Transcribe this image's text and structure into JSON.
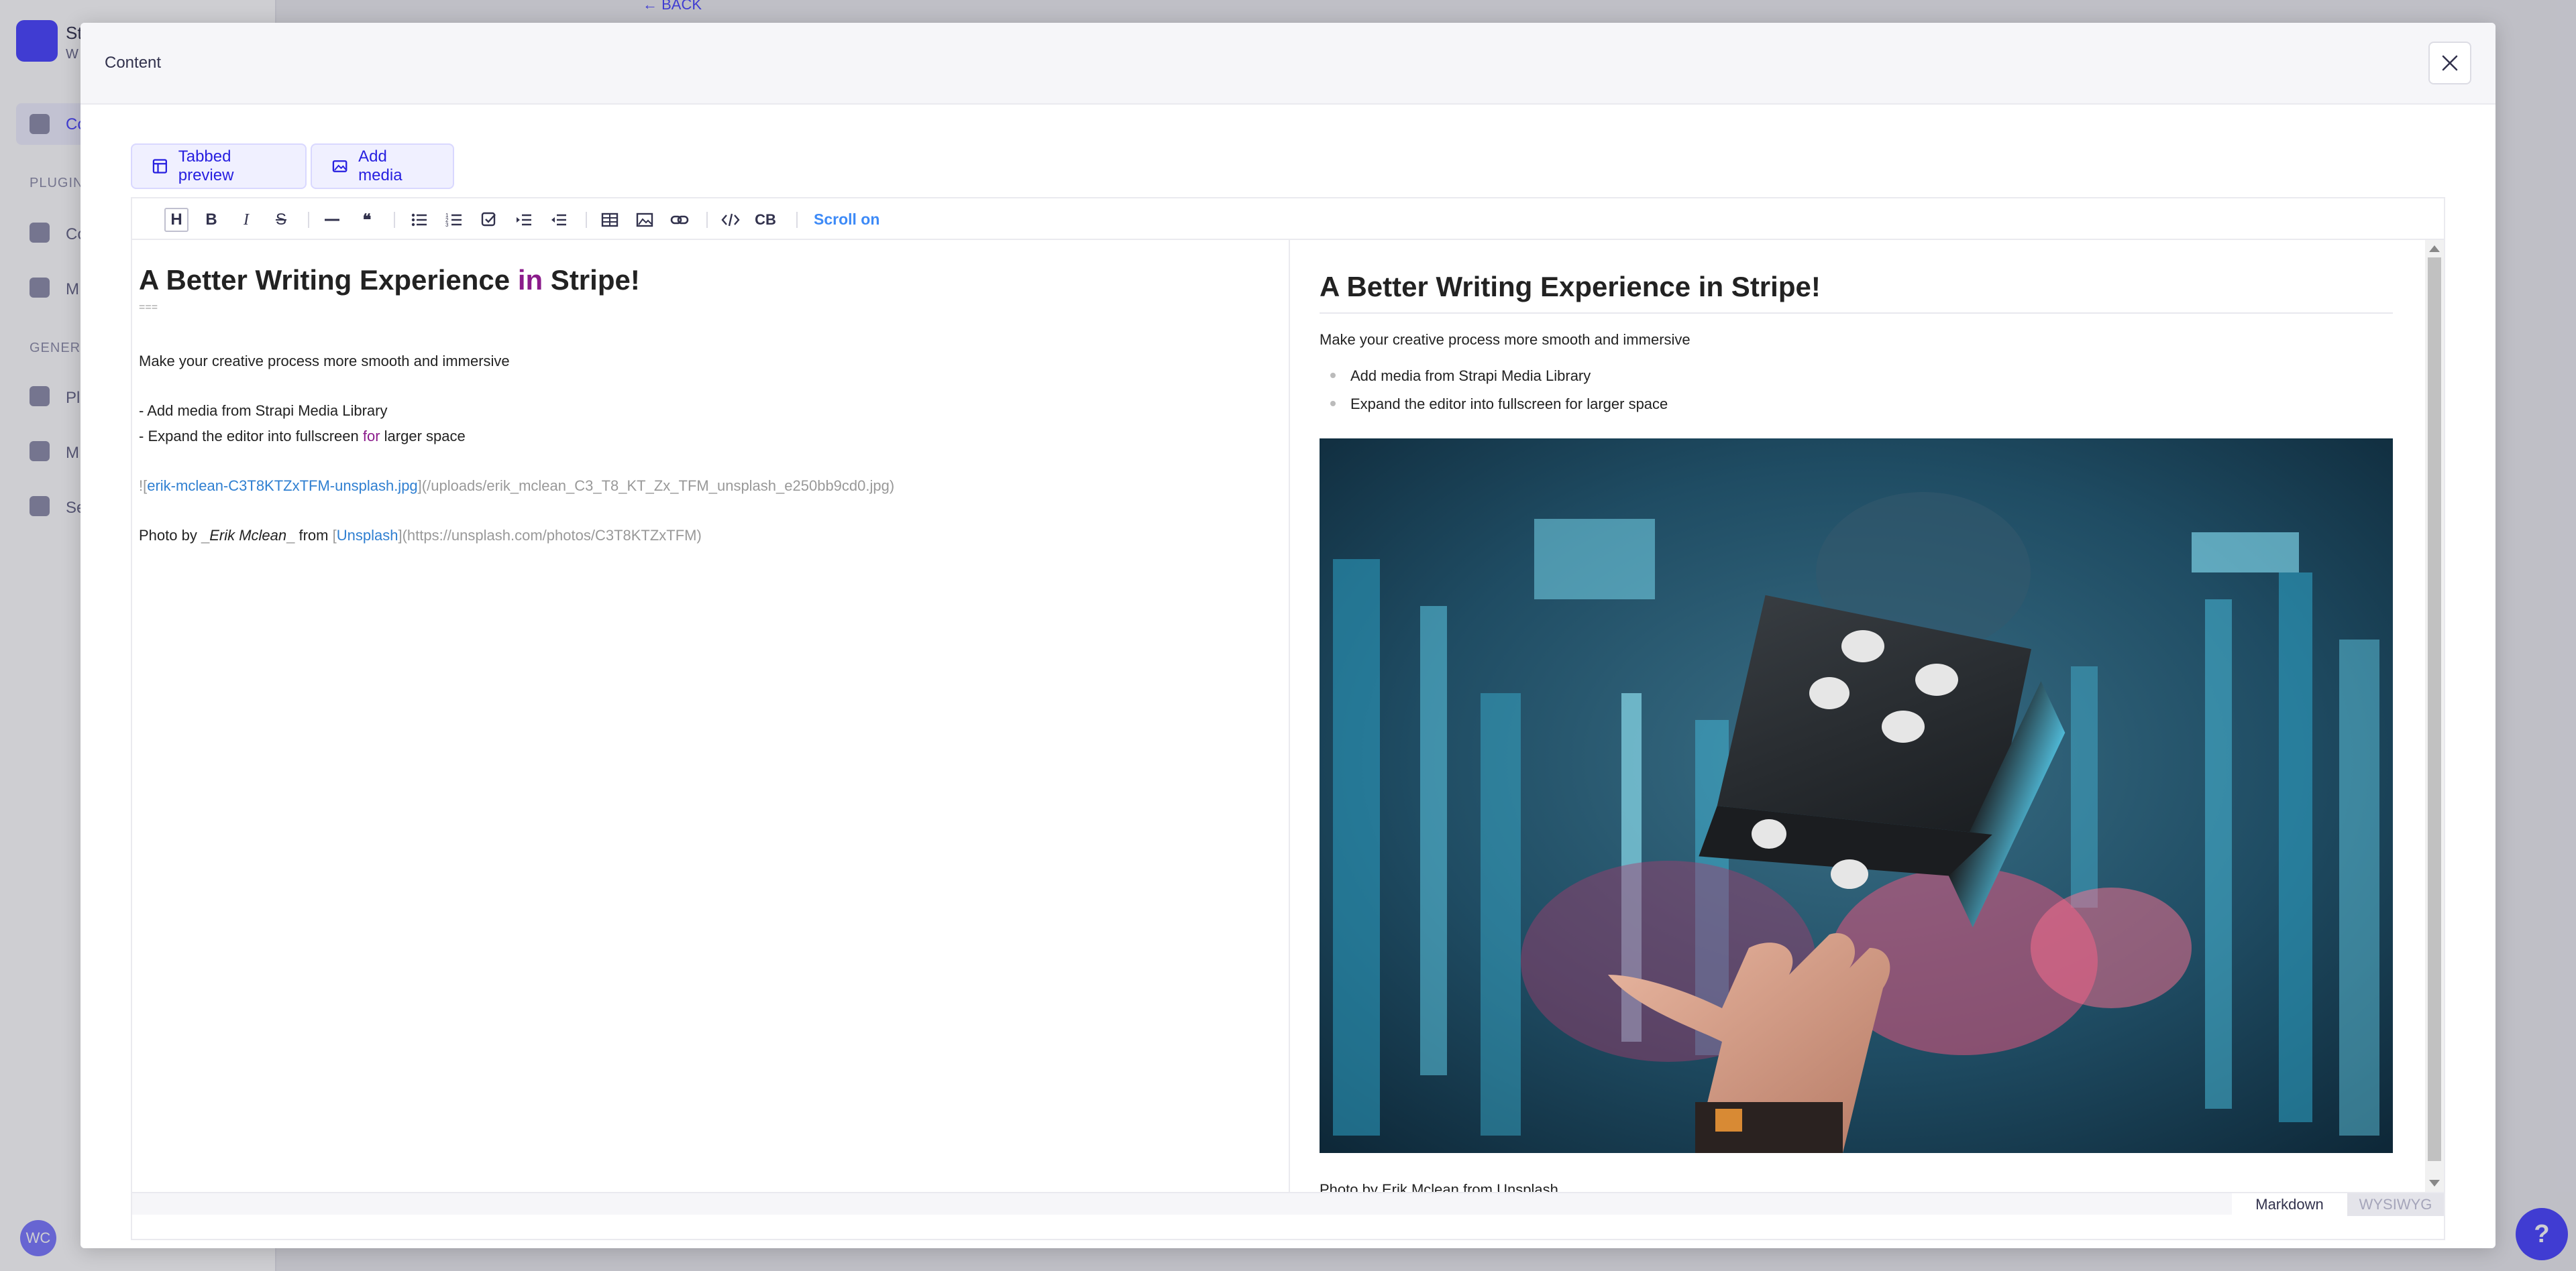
{
  "background": {
    "brand": "St",
    "brand_sub": "W",
    "nav_active": "Co",
    "section_plugins": "PLUGIN",
    "plugin_items": [
      "Co",
      "M"
    ],
    "section_general": "GENERA",
    "general_items": [
      "Pl",
      "M",
      "Se"
    ],
    "back_link": "← BACK",
    "avatar": "WC",
    "help": "?"
  },
  "modal": {
    "title": "Content",
    "close_icon": "close-icon"
  },
  "actions": {
    "tabbed_preview": "Tabbed preview",
    "add_media": "Add media"
  },
  "toolbar": {
    "heading": "H",
    "bold": "B",
    "italic": "I",
    "strike": "S",
    "quote": "❝",
    "code_block": "CB",
    "scroll_on": "Scroll on",
    "icons": [
      "heading-icon",
      "bold-icon",
      "italic-icon",
      "strikethrough-icon",
      "horizontal-rule-icon",
      "quote-icon",
      "bullet-list-icon",
      "ordered-list-icon",
      "task-list-icon",
      "indent-icon",
      "outdent-icon",
      "table-icon",
      "image-icon",
      "link-icon",
      "code-icon",
      "code-block-icon"
    ]
  },
  "markdown": {
    "h1_before": "A Better Writing Experience ",
    "h1_keyword": "in",
    "h1_after": " Stripe!",
    "underline": "===",
    "paragraph": "Make your creative process more smooth and immersive",
    "list_1": "- Add media from Strapi Media Library",
    "list_2_before": "- Expand the editor into fullscreen ",
    "list_2_keyword": "for",
    "list_2_after": " larger space",
    "img_bang": "![",
    "img_alt": "erik-mclean-C3T8KTZxTFM-unsplash.jpg",
    "img_url": "](/uploads/erik_mclean_C3_T8_KT_Zx_TFM_unsplash_e250bb9cd0.jpg)",
    "caption_text": "Photo by ",
    "caption_mark_open": "_",
    "caption_author": "Erik Mclean",
    "caption_mark_close": "_",
    "caption_from": " from ",
    "caption_bracket": "[",
    "caption_site": "Unsplash",
    "caption_url": "](https://unsplash.com/photos/C3T8KTZxTFM)"
  },
  "preview": {
    "h1": "A Better Writing Experience in Stripe!",
    "paragraph": "Make your creative process more smooth and immersive",
    "list": [
      "Add media from Strapi Media Library",
      "Expand the editor into fullscreen for larger space"
    ],
    "caption": "Photo by Erik Mclean from Unsplash"
  },
  "footer": {
    "markdown": "Markdown",
    "wysiwyg": "WYSIWYG"
  }
}
